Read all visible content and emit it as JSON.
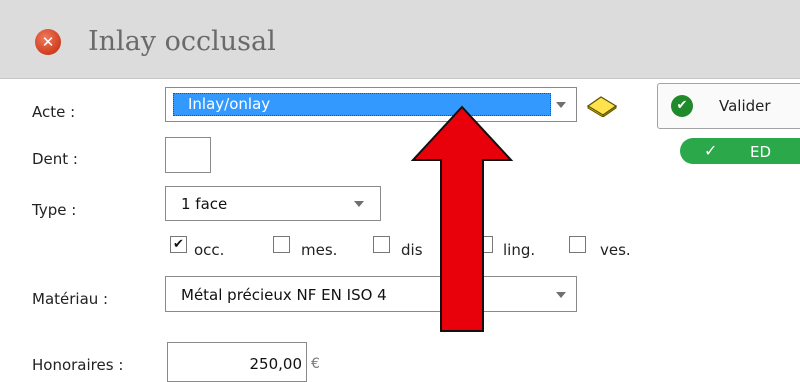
{
  "window": {
    "title": "Inlay occlusal"
  },
  "form": {
    "acte": {
      "label": "Acte :",
      "value": "Inlay/onlay"
    },
    "dent": {
      "label": "Dent :",
      "value": ""
    },
    "type": {
      "label": "Type :",
      "value": "1 face"
    },
    "faces": [
      {
        "label": "occ.",
        "checked": true,
        "mark": "✔"
      },
      {
        "label": "mes.",
        "checked": false,
        "mark": ""
      },
      {
        "label": "dis",
        "checked": false,
        "mark": ""
      },
      {
        "label": "ling.",
        "checked": false,
        "mark": ""
      },
      {
        "label": "ves.",
        "checked": false,
        "mark": ""
      }
    ],
    "materiau": {
      "label": "Matériau :",
      "value": "Métal précieux NF EN ISO 4"
    },
    "honoraires": {
      "label": "Honoraires :",
      "value": "250,00",
      "currency": "€"
    }
  },
  "actions": {
    "valider_label": "Valider",
    "ed_label": "ED",
    "ed_check": "✓"
  },
  "annotation": {
    "arrow_color": "#e8000b"
  }
}
